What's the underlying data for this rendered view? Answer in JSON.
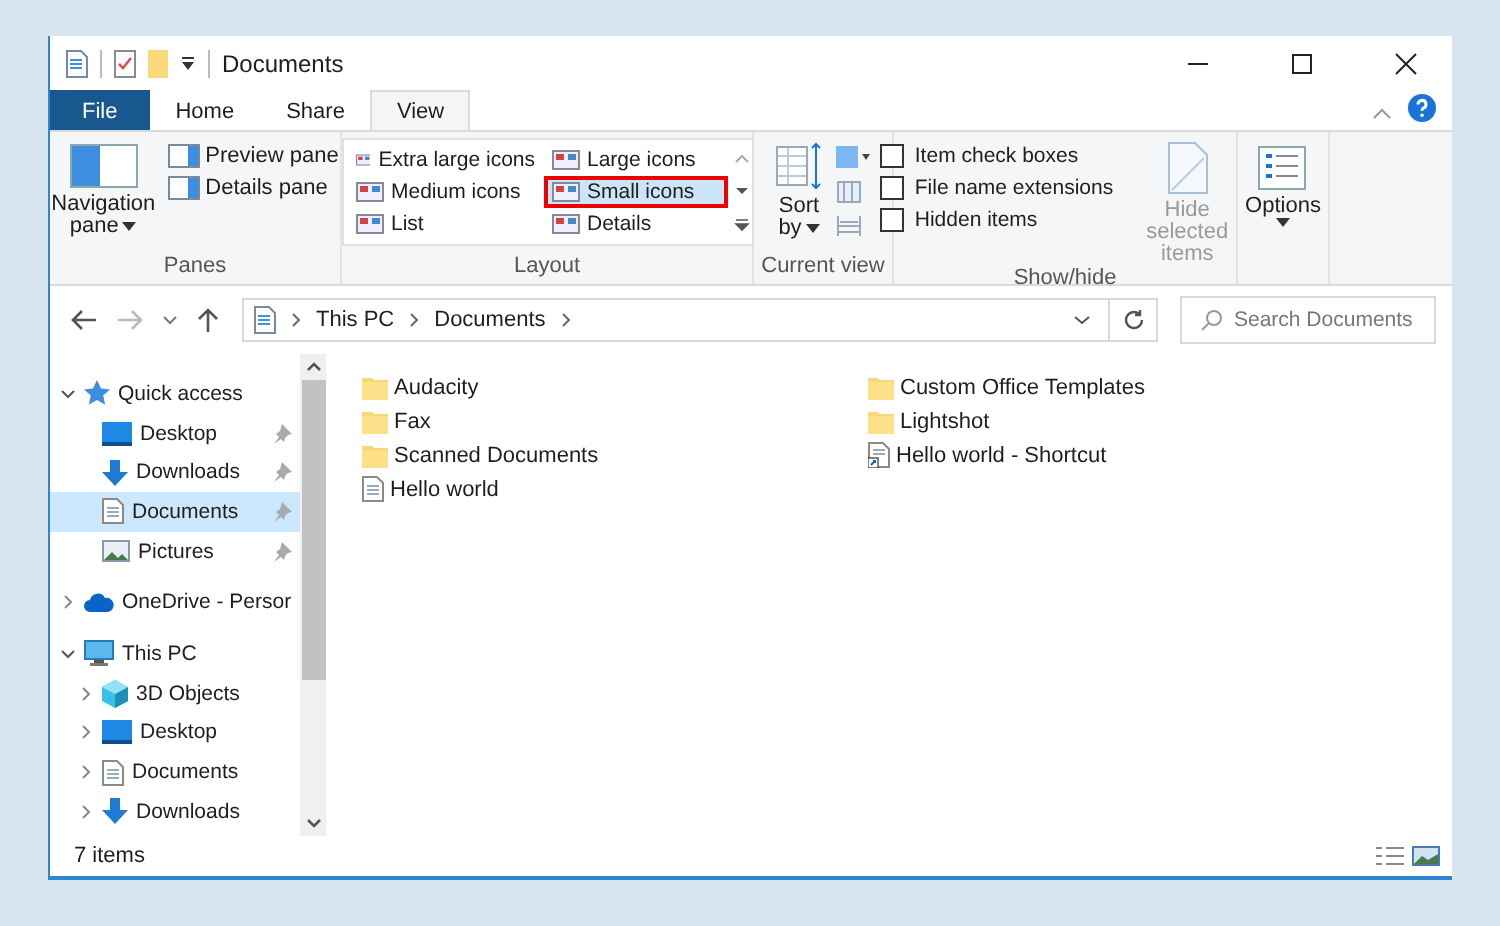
{
  "window": {
    "title": "Documents"
  },
  "tabs": [
    {
      "label": "File",
      "kind": "file",
      "selected": false
    },
    {
      "label": "Home",
      "kind": "tab",
      "selected": false
    },
    {
      "label": "Share",
      "kind": "tab",
      "selected": false
    },
    {
      "label": "View",
      "kind": "tab",
      "selected": true
    }
  ],
  "ribbon": {
    "panes": {
      "label": "Panes",
      "navigation": "Navigation",
      "navigation_2": "pane",
      "items": [
        "Preview pane",
        "Details pane"
      ]
    },
    "layout": {
      "label": "Layout",
      "options": [
        {
          "label": "Extra large icons",
          "selected": false
        },
        {
          "label": "Large icons",
          "selected": false
        },
        {
          "label": "Medium icons",
          "selected": false
        },
        {
          "label": "Small icons",
          "selected": true
        },
        {
          "label": "List",
          "selected": false
        },
        {
          "label": "Details",
          "selected": false
        }
      ]
    },
    "current_view": {
      "label": "Current view",
      "sort": "Sort",
      "sort_2": "by"
    },
    "show_hide": {
      "label": "Show/hide",
      "checkboxes": [
        {
          "label": "Item check boxes",
          "checked": false
        },
        {
          "label": "File name extensions",
          "checked": false
        },
        {
          "label": "Hidden items",
          "checked": false
        }
      ],
      "hide_selected": {
        "label": "Hide selected items",
        "disabled": true
      }
    },
    "options": {
      "label": "Options"
    }
  },
  "address": {
    "crumbs": [
      "This PC",
      "Documents"
    ],
    "search_placeholder": "Search Documents"
  },
  "nav": [
    {
      "label": "Quick access",
      "kind": "star",
      "expanded": true,
      "selected": false,
      "children": [
        {
          "label": "Desktop",
          "kind": "desktop",
          "pinned": true,
          "selected": false
        },
        {
          "label": "Downloads",
          "kind": "download",
          "pinned": true,
          "selected": false
        },
        {
          "label": "Documents",
          "kind": "document",
          "pinned": true,
          "selected": true
        },
        {
          "label": "Pictures",
          "kind": "picture",
          "pinned": true,
          "selected": false
        }
      ]
    },
    {
      "label": "OneDrive - Persor",
      "kind": "cloud",
      "expanded": false,
      "selected": false
    },
    {
      "label": "This PC",
      "kind": "pc",
      "expanded": true,
      "selected": false,
      "children": [
        {
          "label": "3D Objects",
          "kind": "cube",
          "expanded": false,
          "selected": false
        },
        {
          "label": "Desktop",
          "kind": "desktop",
          "expanded": false,
          "selected": false
        },
        {
          "label": "Documents",
          "kind": "document",
          "expanded": false,
          "selected": false
        },
        {
          "label": "Downloads",
          "kind": "download",
          "expanded": false,
          "selected": false
        }
      ]
    }
  ],
  "files": [
    {
      "name": "Audacity",
      "kind": "folder"
    },
    {
      "name": "Fax",
      "kind": "folder"
    },
    {
      "name": "Scanned Documents",
      "kind": "folder"
    },
    {
      "name": "Hello world",
      "kind": "document"
    },
    {
      "name": "Custom Office Templates",
      "kind": "folder"
    },
    {
      "name": "Lightshot",
      "kind": "folder"
    },
    {
      "name": "Hello world - Shortcut",
      "kind": "shortcut"
    }
  ],
  "status_bar": {
    "count": "7 items"
  }
}
